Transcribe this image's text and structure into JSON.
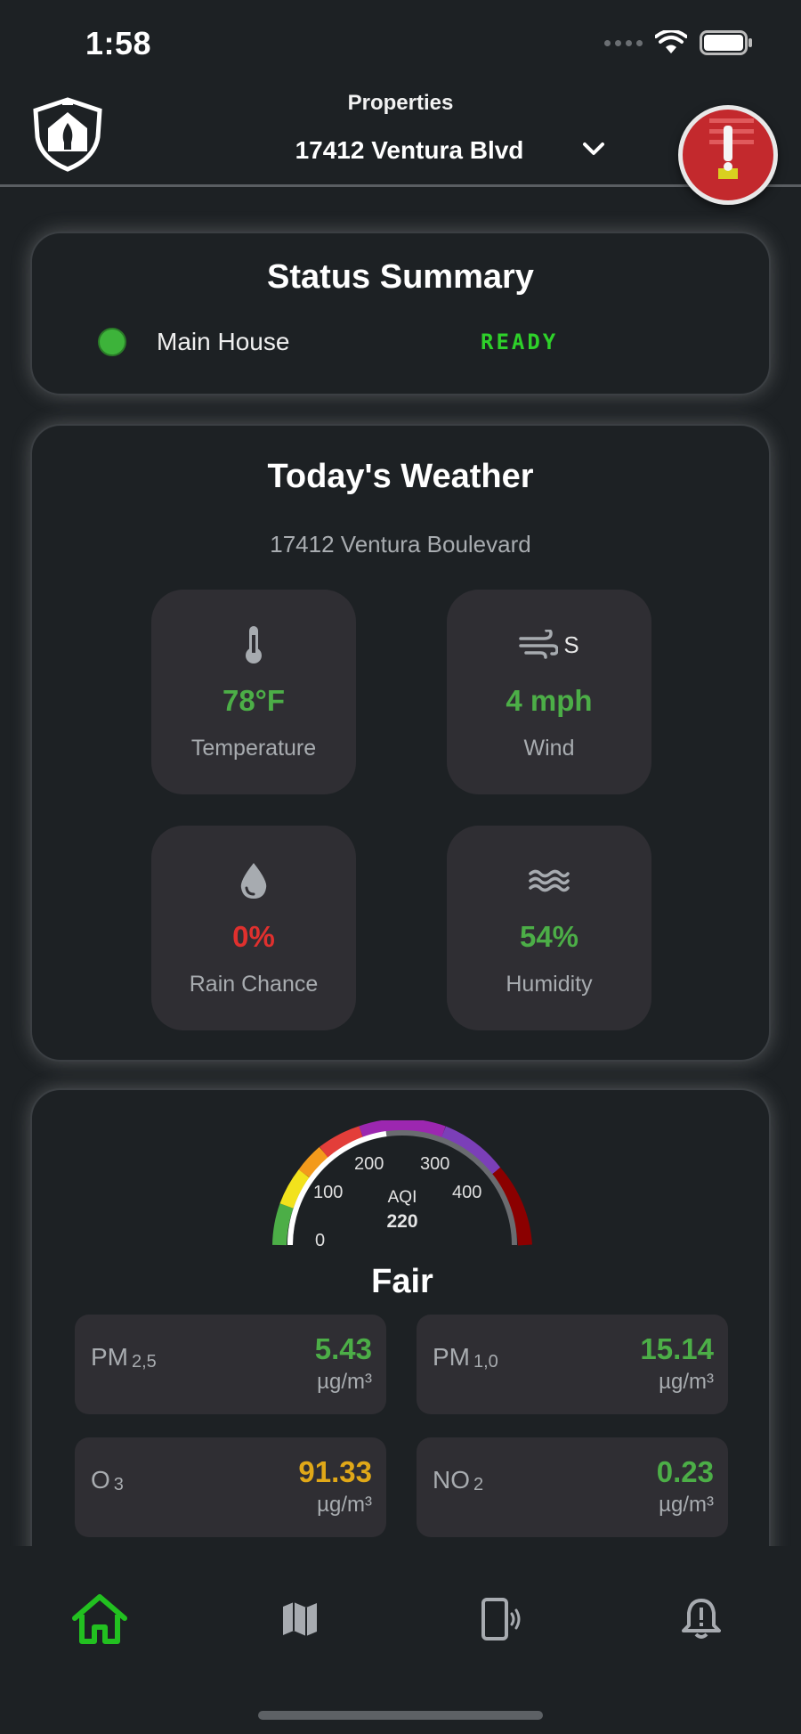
{
  "status_bar": {
    "time": "1:58"
  },
  "header": {
    "properties_label": "Properties",
    "selected_property": "17412 Ventura Blvd"
  },
  "status_summary": {
    "title": "Status Summary",
    "items": [
      {
        "name": "Main House",
        "status": "READY",
        "status_color": "#2ed12a",
        "indicator_color": "#3db33a"
      }
    ]
  },
  "weather": {
    "title": "Today's Weather",
    "address": "17412 Ventura Boulevard",
    "tiles": [
      {
        "icon": "thermometer-icon",
        "value": "78°F",
        "label": "Temperature"
      },
      {
        "icon": "wind-icon",
        "direction": "S",
        "value": "4 mph",
        "label": "Wind"
      },
      {
        "icon": "raindrop-icon",
        "value": "0%",
        "label": "Rain Chance"
      },
      {
        "icon": "humidity-icon",
        "value": "54%",
        "label": "Humidity"
      }
    ]
  },
  "air_quality": {
    "gauge": {
      "ticks": [
        "0",
        "100",
        "200",
        "300",
        "400"
      ],
      "label": "AQI",
      "value": "220",
      "status": "Fair"
    },
    "pollutants": [
      {
        "name": "PM",
        "sub": "2,5",
        "value": "5.43",
        "unit": "µg/m³",
        "color": "#4cae47"
      },
      {
        "name": "PM",
        "sub": "1,0",
        "value": "15.14",
        "unit": "µg/m³",
        "color": "#4cae47"
      },
      {
        "name": "O",
        "sub": "3",
        "value": "91.33",
        "unit": "µg/m³",
        "color": "#e0a818"
      },
      {
        "name": "NO",
        "sub": "2",
        "value": "0.23",
        "unit": "µg/m³",
        "color": "#4cae47"
      }
    ]
  },
  "bottom_nav": {
    "items": [
      {
        "icon": "home-icon",
        "active": true
      },
      {
        "icon": "map-icon",
        "active": false
      },
      {
        "icon": "device-icon",
        "active": false
      },
      {
        "icon": "bell-alert-icon",
        "active": false
      }
    ]
  },
  "colors": {
    "accent_green": "#4cae47",
    "nav_active": "#22c020",
    "background": "#1d2124",
    "tile": "#2f2e33"
  }
}
